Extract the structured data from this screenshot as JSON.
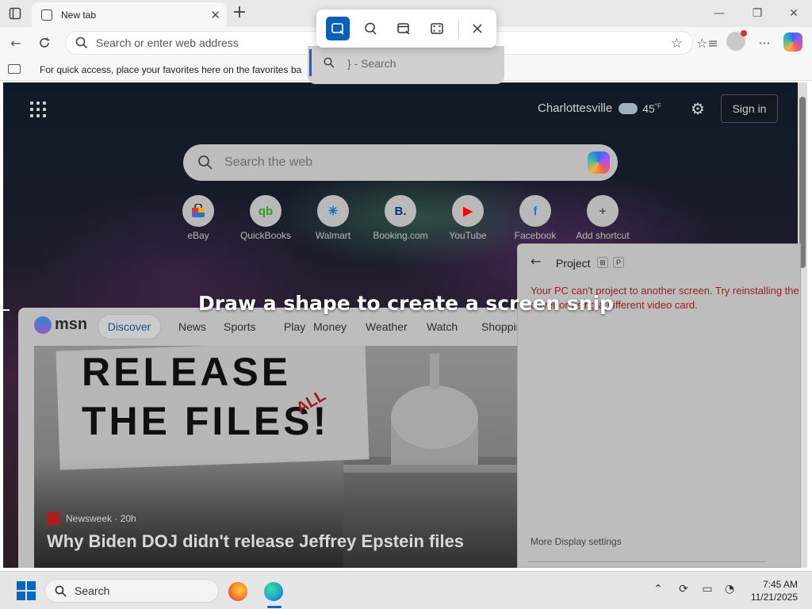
{
  "browser": {
    "tab_title": "New tab",
    "address_placeholder": "Search or enter web address",
    "favorites_bar_text": "For quick access, place your favorites here on the favorites ba"
  },
  "snip": {
    "search_label": "} - Search",
    "instruction": "Draw a shape to create a screen snip",
    "modes": [
      "rectangle-mode",
      "freeform-mode",
      "window-mode",
      "fullscreen-mode"
    ],
    "active_mode": "rectangle-mode"
  },
  "newtab": {
    "weather": {
      "city": "Charlottesville",
      "temp": "45",
      "unit": "°F"
    },
    "signin_label": "Sign in",
    "search_placeholder": "Search the web",
    "shortcuts": [
      {
        "label": "eBay",
        "glyph": "",
        "color": "#2e6fd4"
      },
      {
        "label": "QuickBooks",
        "glyph": "qb",
        "color": "#2ca01c"
      },
      {
        "label": "Walmart",
        "glyph": "✳",
        "color": "#0071ce"
      },
      {
        "label": "Booking.com",
        "glyph": "B.",
        "color": "#003580"
      },
      {
        "label": "YouTube",
        "glyph": "▶",
        "color": "#ff0000"
      },
      {
        "label": "Facebook",
        "glyph": "f",
        "color": "#1877f2"
      },
      {
        "label": "Add shortcut",
        "glyph": "+",
        "color": "#555555"
      }
    ]
  },
  "msn": {
    "logo": "msn",
    "active_tab": "Discover",
    "tabs": [
      "News",
      "Sports",
      "Play",
      "Money",
      "Weather",
      "Watch",
      "Shoppin"
    ],
    "hero": {
      "sign_line1": "RELEASE",
      "sign_line2": "THE FILES!",
      "sign_all": "ALL",
      "source": "Newsweek",
      "age": "· 20h",
      "headline": "Why Biden DOJ didn't release Jeffrey Epstein files"
    }
  },
  "project": {
    "title": "Project",
    "key1": "⊞",
    "key2": "P",
    "error": "Your PC can't project to another screen. Try reinstalling the driver or using a different video card.",
    "more_link": "More Display settings"
  },
  "taskbar": {
    "search_label": "Search",
    "time": "7:45 AM",
    "date": "11/21/2025"
  }
}
